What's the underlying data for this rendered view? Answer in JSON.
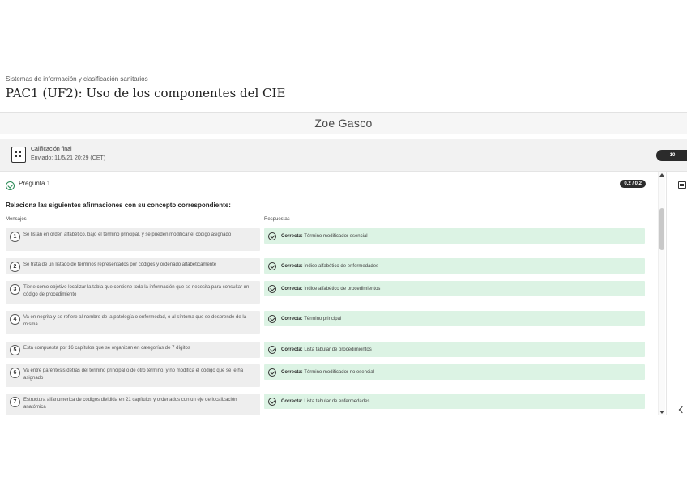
{
  "breadcrumb": "Sistemas de información y clasificación sanitarios",
  "page_title": "PAC1 (UF2): Uso de los componentes del CIE",
  "student_name": "Zoe Gasco",
  "grade": {
    "label": "Calificación final",
    "submitted": "Enviado: 11/5/21 20:29 (CET)",
    "badge": "10"
  },
  "question": {
    "title": "Pregunta 1",
    "score": "0,2 / 0,2",
    "instruction": "Relaciona las siguientes afirmaciones con su concepto correspondiente:",
    "col_left": "Mensajes",
    "col_right": "Respuestas",
    "items": [
      {
        "n": "1",
        "text": "Se listan en orden alfabético, bajo el término principal, y se pueden modificar el código asignado",
        "status": "Correcta:",
        "answer": "Término modificador esencial"
      },
      {
        "n": "2",
        "text": "Se trata de un listado de términos representados por códigos y ordenado alfabéticamente",
        "status": "Correcta:",
        "answer": "Índice alfabético de enfermedades"
      },
      {
        "n": "3",
        "text": "Tiene como objetivo localizar la tabla que contiene toda la información que se necesita para consultar un código de procedimiento",
        "status": "Correcta:",
        "answer": "Índice alfabético de procedimientos"
      },
      {
        "n": "4",
        "text": "Va en negrita y se refiere al nombre de la patología o enfermedad, o al síntoma que se desprende de la misma",
        "status": "Correcta:",
        "answer": "Término principal"
      },
      {
        "n": "5",
        "text": "Está compuesta por 16 capítulos que se organizan en categorías de 7 dígitos",
        "status": "Correcta:",
        "answer": "Lista tabular de procedimientos"
      },
      {
        "n": "6",
        "text": "Va entre paréntesis detrás del término principal o de otro término, y no modifica el código que se le ha asignado",
        "status": "Correcta:",
        "answer": "Término modificador no esencial"
      },
      {
        "n": "7",
        "text": "Estructura alfanumérica de códigos dividida en 21 capítulos y ordenados con un eje de localización anatómica",
        "status": "Correcta:",
        "answer": "Lista tabular de enfermedades"
      }
    ]
  }
}
